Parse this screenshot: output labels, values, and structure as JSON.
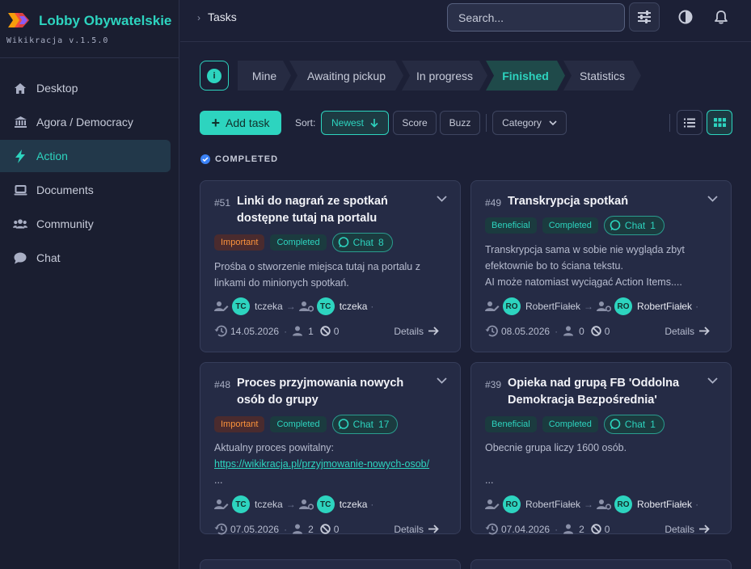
{
  "brand": {
    "title": "Lobby Obywatelskie",
    "version": "Wikikracja v.1.5.0",
    "logo_colors": [
      "#f59e0b",
      "#ef4444",
      "#8b5cf6"
    ]
  },
  "sidebar": {
    "items": [
      {
        "label": "Desktop",
        "icon": "home-icon",
        "active": false
      },
      {
        "label": "Agora / Democracy",
        "icon": "institution-icon",
        "active": false
      },
      {
        "label": "Action",
        "icon": "lightning-icon",
        "active": true
      },
      {
        "label": "Documents",
        "icon": "laptop-icon",
        "active": false
      },
      {
        "label": "Community",
        "icon": "users-icon",
        "active": false
      },
      {
        "label": "Chat",
        "icon": "chat-bubble-icon",
        "active": false
      }
    ]
  },
  "header": {
    "breadcrumb": "Tasks",
    "search_placeholder": "Search..."
  },
  "tabs": [
    {
      "label": "Mine",
      "active": false
    },
    {
      "label": "Awaiting pickup",
      "active": false
    },
    {
      "label": "In progress",
      "active": false
    },
    {
      "label": "Finished",
      "active": true
    },
    {
      "label": "Statistics",
      "active": false
    }
  ],
  "toolbar": {
    "add_label": "Add task",
    "sort_label": "Sort:",
    "sort_newest": "Newest",
    "sort_score": "Score",
    "sort_buzz": "Buzz",
    "category": "Category"
  },
  "section": {
    "title": "COMPLETED"
  },
  "colors": {
    "accent": "#2dd4bf",
    "important": "#fb923c",
    "bg": "#1c2036",
    "card": "#252b45"
  },
  "cards": [
    {
      "num": "#51",
      "title": "Linki do nagrań ze spotkań dostępne tutaj na portalu",
      "tags": [
        "Important",
        "Completed"
      ],
      "chat_label": "Chat",
      "chat_count": "8",
      "desc1": "Prośba o stworzenie miejsca tutaj na portalu z linkami do minionych spotkań.",
      "from_initials": "TC",
      "from_name": "tczeka",
      "to_initials": "TC",
      "to_name": "tczeka",
      "date": "14.05.2026",
      "votes": "1",
      "blocked": "0",
      "details": "Details"
    },
    {
      "num": "#49",
      "title": "Transkrypcja spotkań",
      "tags": [
        "Beneficial",
        "Completed"
      ],
      "chat_label": "Chat",
      "chat_count": "1",
      "desc1": "Transkrypcja sama w sobie nie wygląda zbyt efektownie bo to ściana tekstu.",
      "desc2": "AI może natomiast wyciągać Action Items....",
      "from_initials": "RO",
      "from_name": "RobertFiałek",
      "to_initials": "RO",
      "to_name": "RobertFiałek",
      "date": "08.05.2026",
      "votes": "0",
      "blocked": "0",
      "details": "Details"
    },
    {
      "num": "#48",
      "title": "Proces przyjmowania nowych osób do grupy",
      "tags": [
        "Important",
        "Completed"
      ],
      "chat_label": "Chat",
      "chat_count": "17",
      "desc1": "Aktualny proces powitalny:",
      "link": "https://wikikracja.pl/przyjmowanie-nowych-osob/",
      "desc3": "...",
      "from_initials": "TC",
      "from_name": "tczeka",
      "to_initials": "TC",
      "to_name": "tczeka",
      "date": "07.05.2026",
      "votes": "2",
      "blocked": "0",
      "details": "Details"
    },
    {
      "num": "#39",
      "title": "Opieka nad grupą FB 'Oddolna Demokracja Bezpośrednia'",
      "tags": [
        "Beneficial",
        "Completed"
      ],
      "chat_label": "Chat",
      "chat_count": "1",
      "desc1": "Obecnie grupa liczy 1600 osób.",
      "desc3": "...",
      "from_initials": "RO",
      "from_name": "RobertFiałek",
      "to_initials": "RO",
      "to_name": "RobertFiałek",
      "date": "07.04.2026",
      "votes": "2",
      "blocked": "0",
      "details": "Details"
    }
  ]
}
